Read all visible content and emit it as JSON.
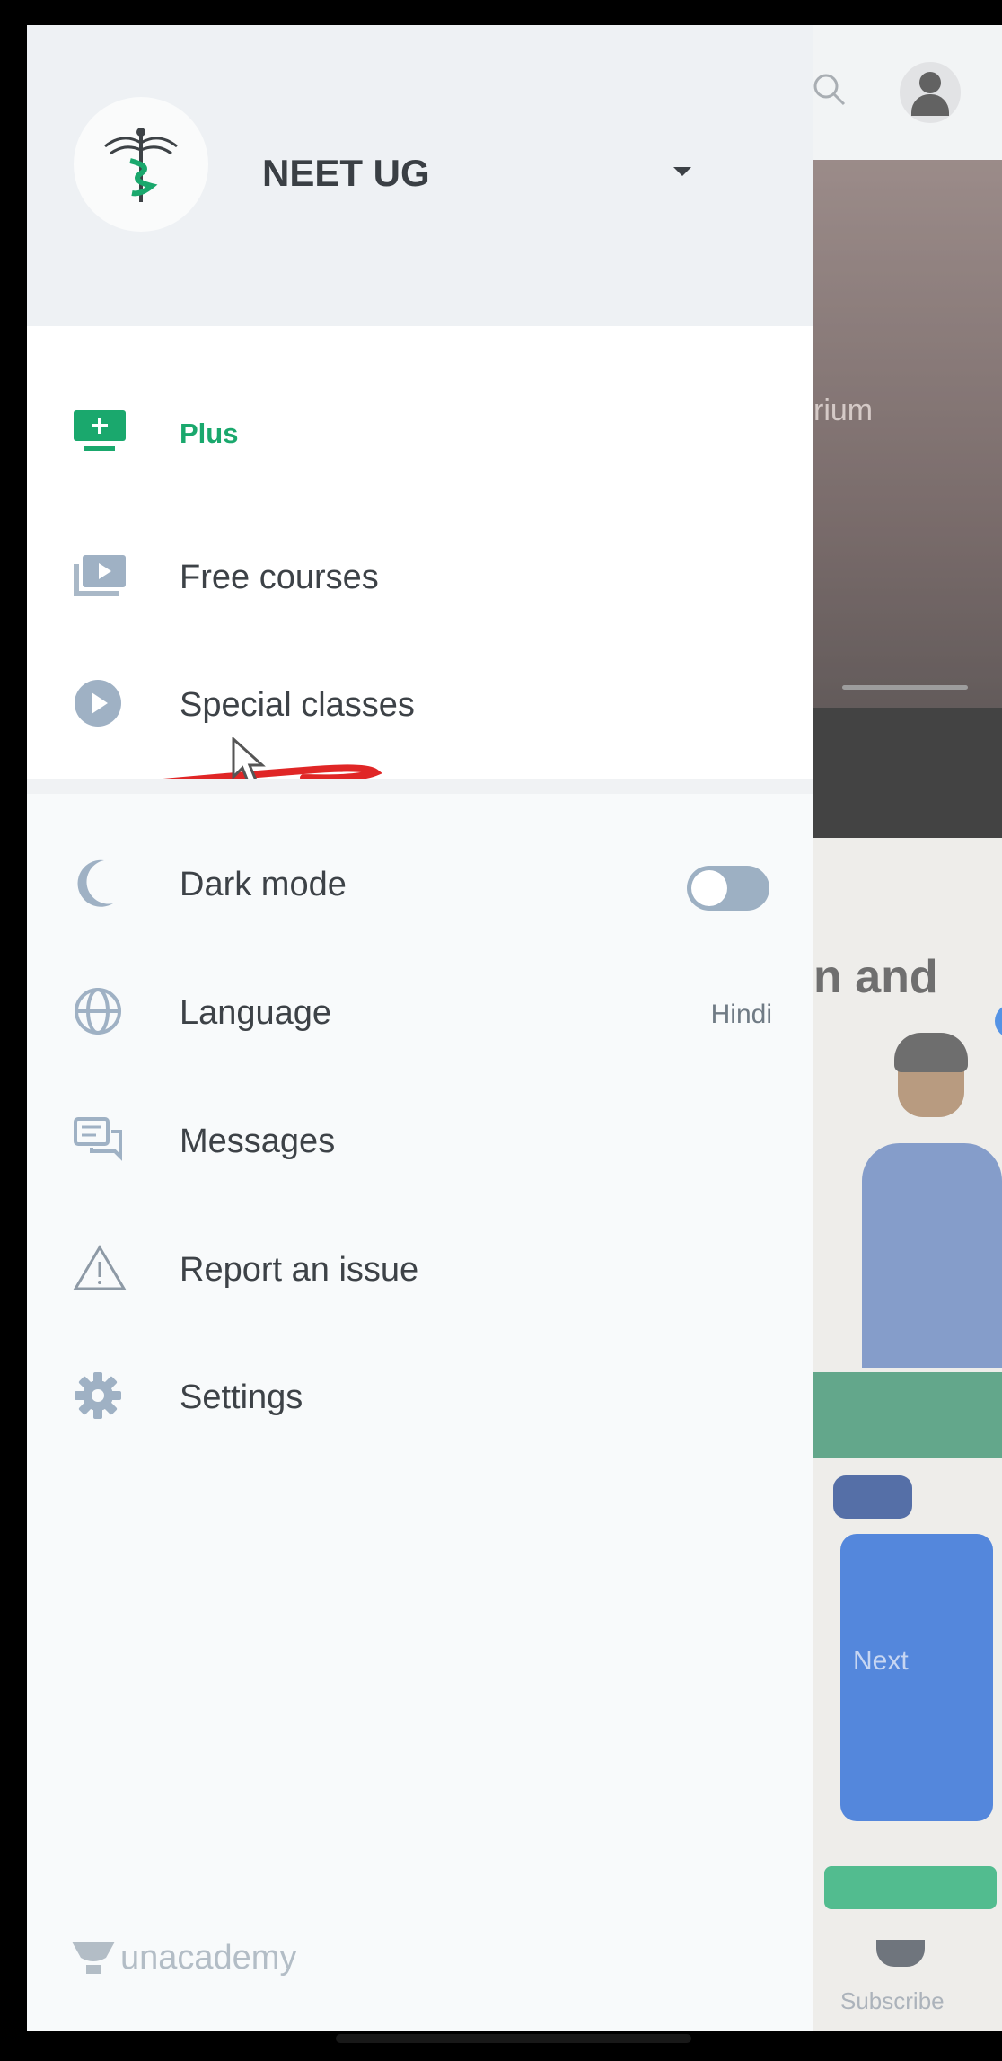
{
  "drawer": {
    "goal": {
      "title": "NEET UG",
      "logo_icon": "caduceus-icon",
      "dropdown_icon": "caret-down-icon"
    },
    "items_top": [
      {
        "label": "Plus",
        "icon": "monitor-plus-icon",
        "color": "#1aa86d"
      },
      {
        "label": "Free courses",
        "icon": "video-library-icon"
      },
      {
        "label": "Special classes",
        "icon": "play-circle-icon"
      }
    ],
    "items_bottom": [
      {
        "label": "Dark mode",
        "icon": "moon-icon",
        "toggle": false
      },
      {
        "label": "Language",
        "icon": "globe-icon",
        "value": "Hindi"
      },
      {
        "label": "Messages",
        "icon": "chat-icon"
      },
      {
        "label": "Report an issue",
        "icon": "warning-triangle-icon"
      },
      {
        "label": "Settings",
        "icon": "gear-icon"
      }
    ],
    "brand": {
      "name": "unacademy"
    }
  },
  "background": {
    "video_text": "rium",
    "heading": "n and",
    "button_label": "Next",
    "nav_label": "Subscribe"
  },
  "colors": {
    "accent": "#1aa86d",
    "toggle_off": "#9db0c3",
    "annotation_red": "#e02626"
  }
}
